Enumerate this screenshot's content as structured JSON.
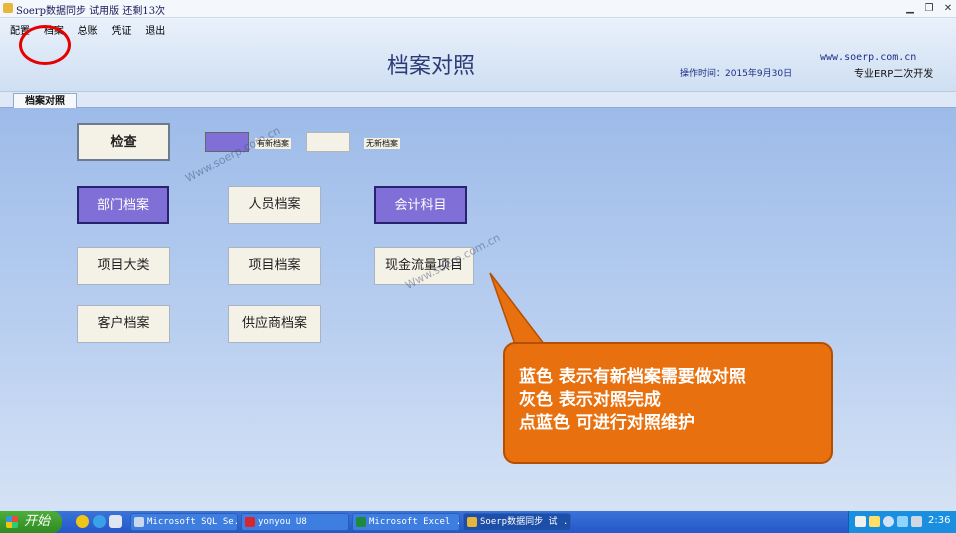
{
  "window": {
    "title": "Soerp数据同步 试用版  还剩13次"
  },
  "menu": [
    {
      "id": "setup",
      "label": "配置"
    },
    {
      "id": "archive",
      "label": "档案"
    },
    {
      "id": "summary",
      "label": "总账"
    },
    {
      "id": "voucher",
      "label": "凭证"
    },
    {
      "id": "exit",
      "label": "退出"
    }
  ],
  "header": {
    "heading": "档案对照",
    "website": "www.soerp.com.cn",
    "operation_time": "操作时间：2015年9月30日",
    "slogan": "专业ERP二次开发"
  },
  "tab": {
    "label": "档案对照"
  },
  "buttons": {
    "check": "检查",
    "dept": "部门档案",
    "person": "人员档案",
    "account": "会计科目",
    "project_class": "项目大类",
    "project": "项目档案",
    "cashflow": "现金流量项目",
    "customer": "客户档案",
    "supplier": "供应商档案"
  },
  "legend": {
    "new_label": "有新档案",
    "none_label": "无新档案",
    "new_color": "#7f6fd6",
    "none_color": "#f4f1e6"
  },
  "watermark": "Www.soerp.com.cn",
  "callout": {
    "line1": "蓝色  表示有新档案需要做对照",
    "line2": "灰色  表示对照完成",
    "line3": "点蓝色   可进行对照维护",
    "color": "#e8700e"
  },
  "taskbar": {
    "start": "开始",
    "tasks": [
      {
        "label": "Microsoft SQL Se..."
      },
      {
        "label": "yonyou U8"
      },
      {
        "label": "Microsoft Excel ..."
      },
      {
        "label": "Soerp数据同步 试 ..."
      }
    ],
    "clock": "2:36"
  }
}
